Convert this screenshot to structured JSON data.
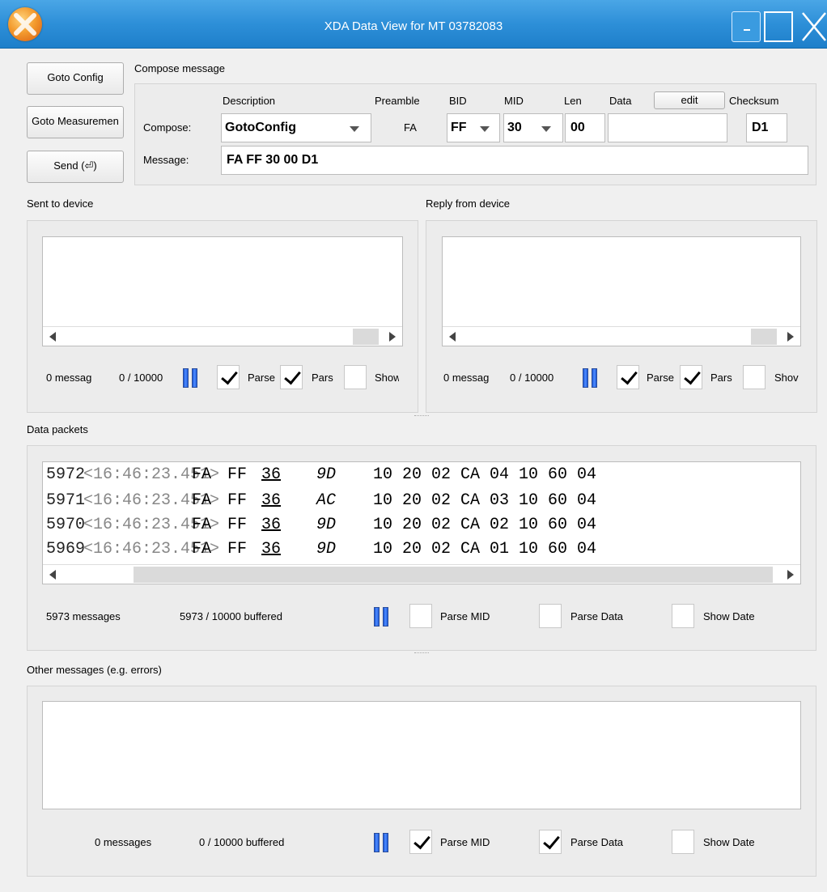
{
  "window": {
    "title": "XDA Data View for MT 03782083"
  },
  "toolbar": {
    "goto_config": "Goto Config",
    "goto_measurement": "Goto Measuremen",
    "send": "Send (⏎)"
  },
  "compose": {
    "group_title": "Compose message",
    "headers": {
      "description": "Description",
      "preamble": "Preamble",
      "bid": "BID",
      "mid": "MID",
      "len": "Len",
      "data": "Data",
      "edit": "edit",
      "checksum": "Checksum"
    },
    "compose_label": "Compose:",
    "message_label": "Message:",
    "description_value": "GotoConfig",
    "preamble_value": "FA",
    "bid_value": "FF",
    "mid_value": "30",
    "len_value": "00",
    "data_value": "",
    "checksum_value": "D1",
    "message_value": "FA FF 30 00 D1"
  },
  "sent_panel": {
    "title": "Sent to device",
    "messages": "0 messag",
    "buffered": "0 / 10000",
    "parse_mid": "Parse",
    "parse_data": "Pars",
    "show_date": "Show",
    "parse_mid_checked": true,
    "parse_data_checked": true,
    "show_date_checked": false
  },
  "reply_panel": {
    "title": "Reply from device",
    "messages": "0 messag",
    "buffered": "0 / 10000",
    "parse_mid": "Parse",
    "parse_data": "Pars",
    "show_date": "Shov",
    "parse_mid_checked": true,
    "parse_data_checked": true,
    "show_date_checked": false
  },
  "packets_panel": {
    "title": "Data packets",
    "rows": [
      {
        "seq": "5972",
        "time": "<16:46:23.451>",
        "pre": "FA",
        "bid": "FF",
        "mid": "36",
        "len": "9D",
        "data": "10 20 02 CA 04 10 60 04"
      },
      {
        "seq": "5971",
        "time": "<16:46:23.451>",
        "pre": "FA",
        "bid": "FF",
        "mid": "36",
        "len": "AC",
        "data": "10 20 02 CA 03 10 60 04"
      },
      {
        "seq": "5970",
        "time": "<16:46:23.451>",
        "pre": "FA",
        "bid": "FF",
        "mid": "36",
        "len": "9D",
        "data": "10 20 02 CA 02 10 60 04"
      },
      {
        "seq": "5969",
        "time": "<16:46:23.451>",
        "pre": "FA",
        "bid": "FF",
        "mid": "36",
        "len": "9D",
        "data": "10 20 02 CA 01 10 60 04"
      }
    ],
    "messages": "5973 messages",
    "buffered": "5973 / 10000 buffered",
    "parse_mid": "Parse MID",
    "parse_data": "Parse Data",
    "show_date": "Show Date",
    "parse_mid_checked": false,
    "parse_data_checked": false,
    "show_date_checked": false
  },
  "other_panel": {
    "title": "Other messages (e.g. errors)",
    "messages": "0 messages",
    "buffered": "0 / 10000 buffered",
    "parse_mid": "Parse MID",
    "parse_data": "Parse Data",
    "show_date": "Show Date",
    "parse_mid_checked": true,
    "parse_data_checked": true,
    "show_date_checked": false
  }
}
